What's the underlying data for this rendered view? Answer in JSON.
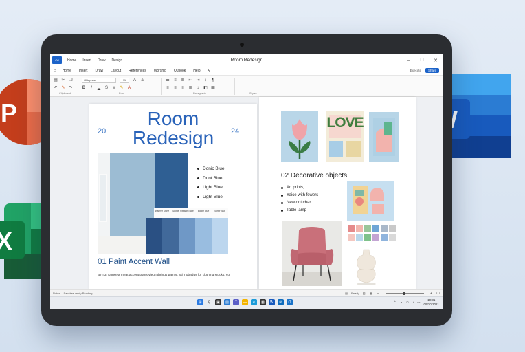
{
  "window": {
    "autosave_label": "Off",
    "menu": [
      "Home",
      "Insert",
      "Draw",
      "Design"
    ],
    "title": "Room Redesign",
    "controls": [
      "–",
      "□",
      "✕"
    ]
  },
  "ribbon_tabs": {
    "tabs": [
      "Home",
      "Insert",
      "Draw",
      "Layout",
      "References",
      "Worship",
      "Outlook",
      "Help"
    ],
    "execute_label": "Execute",
    "share_label": "Share"
  },
  "ribbon": {
    "font_name": "Glitepress",
    "font_size": "11",
    "groups": [
      "Clipboard",
      "Font",
      "Paragraph",
      "Styles"
    ]
  },
  "left_page": {
    "title_line1": "Room",
    "title_line2": "Redesign",
    "page_left_num": "20",
    "page_right_num": "24",
    "swatches": [
      {
        "label": "Warmer Stone",
        "color": "#2a5083"
      },
      {
        "label": "Soothe Stone",
        "color": "#41699a"
      },
      {
        "label": "Pleasant Blue",
        "color": "#6f98c6"
      },
      {
        "label": "Bolder Blue",
        "color": "#99bde0"
      },
      {
        "label": "Softer Blue",
        "color": "#bcd6ee"
      }
    ],
    "color_list": [
      "Donic Blue",
      "Dont Blue",
      "Light Blue",
      "Light Blue"
    ],
    "section_heading": "01 Paint Accent Wall",
    "body_text": "Birn 3. Konsela meat accent plans vieun thrings paints. Stil nobadus for clothing stocks. so"
  },
  "right_page": {
    "love_word": "LOVE",
    "section_heading": "02 Decorative objects",
    "deco_items": [
      "Art prints,",
      "Yaice with fowers",
      "New ont char",
      "Table lamp"
    ],
    "palette": [
      "#e58b8b",
      "#f2b6ae",
      "#9ac69a",
      "#6fa6d6",
      "#a9b8c9",
      "#c9c9c9",
      "#f4c7c0",
      "#b8d7ea",
      "#7fc28b",
      "#c3a4d3",
      "#8fb4dd",
      "#d9d9d9"
    ]
  },
  "statusbar": {
    "left1": "Notes",
    "left2": "Sakekes cenfy Reading",
    "focus": "Ready",
    "zoom": "115"
  },
  "taskbar": {
    "time": "10:31",
    "date": "09/30/2021"
  },
  "icons": {
    "powerpoint": "P",
    "excel": "X",
    "word": "W"
  }
}
